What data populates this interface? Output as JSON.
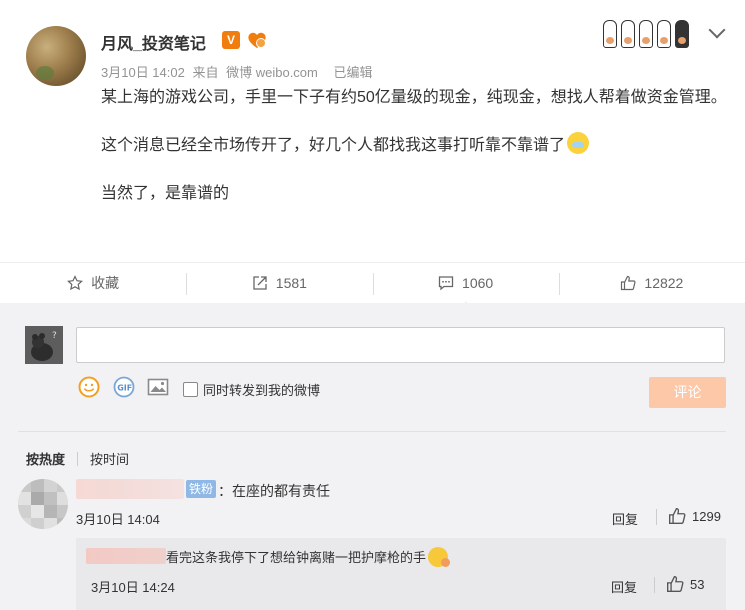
{
  "post": {
    "username": "月风_投资笔记",
    "verified_badge": "V",
    "date": "3月10日 14:02",
    "source_prefix": "来自",
    "source": "微博 weibo.com",
    "edited": "已编辑",
    "paragraphs": [
      "某上海的游戏公司，手里一下子有约50亿量级的现金，纯现金，想找人帮着做资金管理。",
      "这个消息已经全市场传开了，好几个人都找我这事打听靠不靠谱了",
      "当然了，是靠谱的"
    ],
    "icons": {
      "avatar": "user-avatar",
      "badge": "verified-v-icon",
      "fan": "fan-badge-icon",
      "more": "chevron-down-icon",
      "emoji": "crying-laughing-emoji"
    }
  },
  "actions": {
    "favorite": {
      "label": "收藏",
      "icon": "star-icon"
    },
    "repost": {
      "label": "1581",
      "icon": "repost-icon"
    },
    "comment": {
      "label": "1060",
      "icon": "comment-icon"
    },
    "like": {
      "label": "12822",
      "icon": "thumbs-up-icon"
    }
  },
  "composer": {
    "placeholder": "",
    "repost_checkbox_label": "同时转发到我的微博",
    "submit_label": "评论",
    "icons": [
      "smile-icon",
      "gif-icon",
      "image-icon"
    ]
  },
  "sort": {
    "selected": "按热度",
    "other": "按时间"
  },
  "comments": [
    {
      "badge": "铁粉",
      "text": "：在座的都有责任",
      "time": "3月10日 14:04",
      "reply_label": "回复",
      "likes": "1299",
      "replies": [
        {
          "text": "看完这条我停下了想给钟离赌一把护摩枪的手",
          "time": "3月10日 14:24",
          "reply_label": "回复",
          "likes": "53"
        }
      ]
    }
  ],
  "colors": {
    "accent": "#f07d0d",
    "submit_disabled": "#fdc8a8",
    "fan_badge": "#8fb8e6",
    "background": "#f2f2f5"
  }
}
